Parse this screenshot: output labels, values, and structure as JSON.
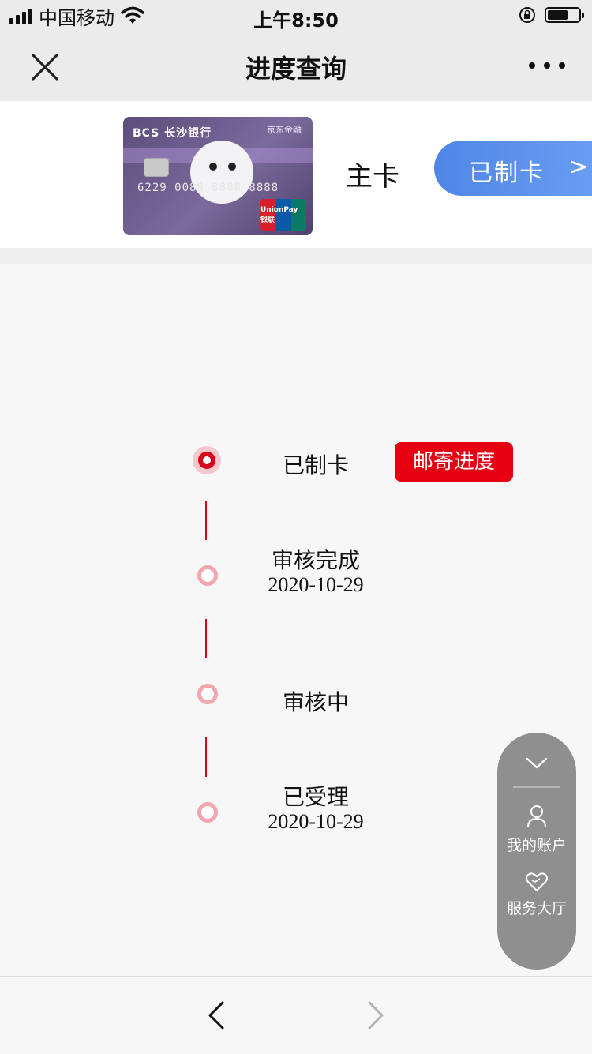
{
  "status_bar": {
    "carrier": "中国移动",
    "time": "上午8:50",
    "icons": [
      "signal-icon",
      "wifi-icon",
      "orientation-lock-icon",
      "battery-icon"
    ],
    "battery_level": 0.6
  },
  "nav": {
    "title": "进度查询",
    "close_icon": "close-icon",
    "more_icon": "more-icon"
  },
  "card": {
    "bank_text": "BCS 长沙银行",
    "partner_text": "京东金融",
    "number": "6229 0088 8888 8888",
    "network": "UnionPay 银联",
    "card_type": "主卡",
    "status_button": "已制卡",
    "status_arrow": ">"
  },
  "timeline": {
    "steps": [
      {
        "label": "已制卡",
        "date": "",
        "active": true
      },
      {
        "label": "审核完成",
        "date": "2020-10-29",
        "active": false
      },
      {
        "label": "审核中",
        "date": "",
        "active": false
      },
      {
        "label": "已受理",
        "date": "2020-10-29",
        "active": false
      }
    ],
    "mail_button": "邮寄进度"
  },
  "float_menu": {
    "items": [
      {
        "label": "我的账户",
        "icon": "user-icon"
      },
      {
        "label": "服务大厅",
        "icon": "heart-icon"
      }
    ],
    "collapse_icon": "chevron-down-icon"
  },
  "bottom_nav": {
    "back_icon": "chevron-left-icon",
    "forward_icon": "chevron-right-icon"
  },
  "colors": {
    "accent_red": "#e60012",
    "timeline_red": "#d8061d",
    "pill_blue": "#5a90ea",
    "float_gray": "#8f8f8f"
  }
}
